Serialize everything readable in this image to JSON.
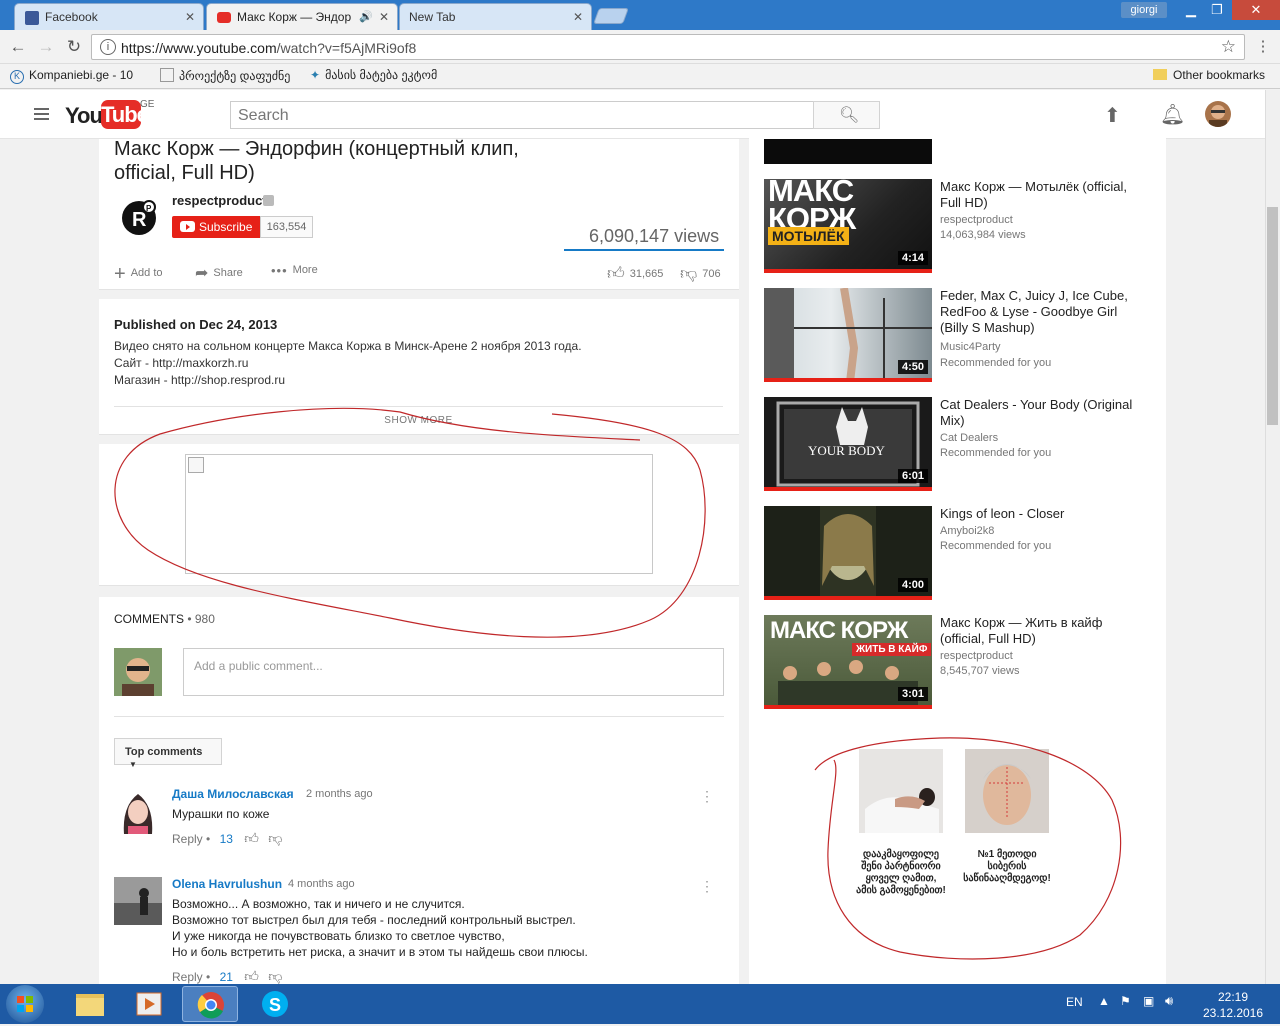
{
  "browser": {
    "tabs": [
      {
        "label": "Facebook",
        "favicon_color": "#3b5998"
      },
      {
        "label": "Макс Корж — Эндор",
        "favicon_color": "#e52d27",
        "audio": "🔊"
      },
      {
        "label": "New Tab",
        "favicon_color": ""
      }
    ],
    "user": "giorgi",
    "url_host": "https://www.youtube.com",
    "url_path": "/watch?v=f5AjMRi9of8",
    "bookmarks": [
      "Kompaniebi.ge - 10",
      "პროექტზე დაფუძნე",
      "მასის მატება ეკტომ"
    ],
    "other_bookmarks": "Other bookmarks"
  },
  "youtube": {
    "logo_you": "You",
    "logo_tube": "Tube",
    "region": "GE",
    "search_placeholder": "Search",
    "video": {
      "title": "Макс Корж — Эндорфин (концертный клип, official, Full HD)",
      "channel": "respectproduct",
      "subscribe": "Subscribe",
      "subscribers": "163,554",
      "views": "6,090,147 views",
      "add_to": "Add to",
      "share": "Share",
      "more": "More",
      "likes": "31,665",
      "dislikes": "706"
    },
    "description": {
      "published": "Published on Dec 24, 2013",
      "lines": [
        "Видео снято на сольном концерте Макса Коржа в Минск-Арене 2 ноября 2013 года.",
        "Сайт - http://maxkorzh.ru",
        "Магазин - http://shop.resprod.ru"
      ],
      "show_more": "SHOW MORE"
    },
    "comments": {
      "label": "COMMENTS",
      "separator": " • ",
      "count": "980",
      "placeholder": "Add a public comment...",
      "sort": "Top comments",
      "items": [
        {
          "author": "Даша Милославская",
          "time": "2 months ago",
          "text": [
            "Мурашки по коже"
          ],
          "reply": "Reply",
          "likes": "13"
        },
        {
          "author": "Olena Havrulushun",
          "time": "4 months ago",
          "text": [
            "Возможно... А возможно, так и ничего и не случится.",
            "Возможно тот выстрел был для тебя - последний контрольный выстрел.",
            "И уже никогда не почувствовать близко то светлое чувство,",
            "Но и боль встретить нет риска, а значит и в этом ты найдешь свои плюсы."
          ],
          "reply": "Reply",
          "likes": "21"
        }
      ]
    },
    "related": [
      {
        "title": "Макс Корж — Мотылёк (official, Full HD)",
        "channel": "respectproduct",
        "meta": "14,063,984 views",
        "duration": "4:14",
        "thumb_text": "МАКС КОРЖ",
        "thumb_sub": "МОТЫЛЁК"
      },
      {
        "title": "Feder, Max C, Juicy J, Ice Cube, RedFoo & Lyse - Goodbye Girl (Billy S Mashup)",
        "channel": "Music4Party",
        "meta": "Recommended for you",
        "duration": "4:50"
      },
      {
        "title": "Cat Dealers - Your Body (Original Mix)",
        "channel": "Cat Dealers",
        "meta": "Recommended for you",
        "duration": "6:01",
        "thumb_text": "YOUR BODY"
      },
      {
        "title": "Kings of leon - Closer",
        "channel": "Amyboi2k8",
        "meta": "Recommended for you",
        "duration": "4:00"
      },
      {
        "title": "Макс Корж — Жить в кайф (official, Full HD)",
        "channel": "respectproduct",
        "meta": "8,545,707 views",
        "duration": "3:01",
        "thumb_text": "МАКС КОРЖ",
        "thumb_sub": "ЖИТЬ В КАЙФ"
      }
    ],
    "ads": [
      {
        "text": "დააკმაყოფილე შენი პარტნიორი ყოველ ღამით, ამის გამოყენებით!"
      },
      {
        "text": "№1 მეთოდი სიბერის საწინააღმდეგოდ!"
      }
    ]
  },
  "taskbar": {
    "lang": "EN",
    "time": "22:19",
    "date": "23.12.2016"
  },
  "colors": {
    "yt_red": "#e62117",
    "link_blue": "#167ac6",
    "annotation": "#c0282a",
    "taskbar": "#1e5aa4"
  }
}
